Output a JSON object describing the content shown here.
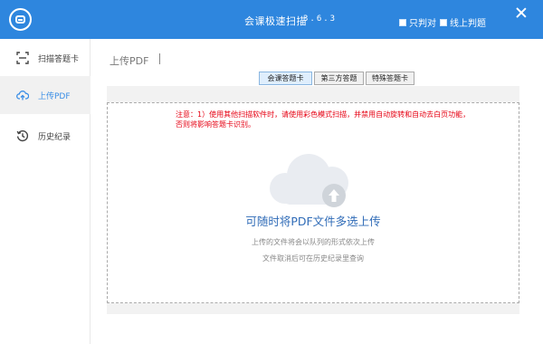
{
  "titlebar": {
    "app_title": "会课极速扫描",
    "version": "3.6.3",
    "options": [
      "只判对",
      "线上判题"
    ]
  },
  "sidebar": {
    "items": [
      {
        "label": "扫描答题卡",
        "icon": "scan-frame-icon",
        "active": false
      },
      {
        "label": "上传PDF",
        "icon": "cloud-upload-icon",
        "active": true
      },
      {
        "label": "历史纪录",
        "icon": "history-clock-icon",
        "active": false
      }
    ]
  },
  "main": {
    "page_title": "上传PDF",
    "tabs": [
      {
        "label": "会课答题卡",
        "active": true
      },
      {
        "label": "第三方答题卡",
        "active": false
      },
      {
        "label": "特殊答题卡",
        "active": false
      }
    ],
    "notice_line1": "注意：1）使用其他扫描软件时，请使用彩色模式扫描，并禁用自动旋转和自动去白页功能，",
    "notice_line2": "否则将影响答题卡识别。",
    "upload_title": "可随时将PDF文件多选上传",
    "upload_sub1": "上传的文件将会以队列的形式依次上传",
    "upload_sub2": "文件取消后可在历史纪录里查询"
  },
  "colors": {
    "titlebar": "#2e86de",
    "accent": "#3a8ee6",
    "notice": "#e60012",
    "upload_title": "#2f6bb7"
  }
}
